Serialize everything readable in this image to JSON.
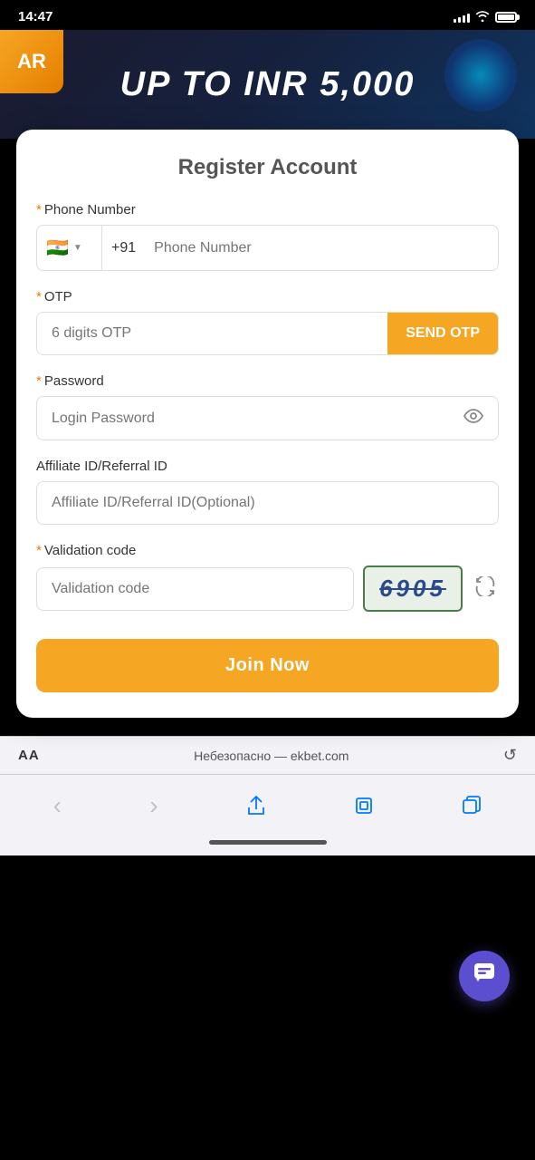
{
  "statusBar": {
    "time": "14:47",
    "batteryAlt": "battery"
  },
  "banner": {
    "text": "UP TO INR 5,000",
    "ar": "AR"
  },
  "form": {
    "title": "Register Account",
    "phoneLabel": "Phone Number",
    "phoneCountryCode": "+91",
    "phonePlaceholder": "Phone Number",
    "otpLabel": "OTP",
    "otpPlaceholder": "6 digits OTP",
    "sendOtpLabel": "SEND OTP",
    "passwordLabel": "Password",
    "passwordPlaceholder": "Login Password",
    "affiliateLabel": "Affiliate ID/Referral ID",
    "affiliatePlaceholder": "Affiliate ID/Referral ID(Optional)",
    "validationLabel": "Validation code",
    "validationPlaceholder": "Validation code",
    "captchaValue": "6905",
    "joinLabel": "Join Now"
  },
  "browser": {
    "aa": "AA",
    "url": "Небезопасно — ekbet.com",
    "reloadIcon": "↺"
  },
  "nav": {
    "back": "‹",
    "forward": "›",
    "share": "↑",
    "bookmarks": "□",
    "tabs": "⧉"
  }
}
